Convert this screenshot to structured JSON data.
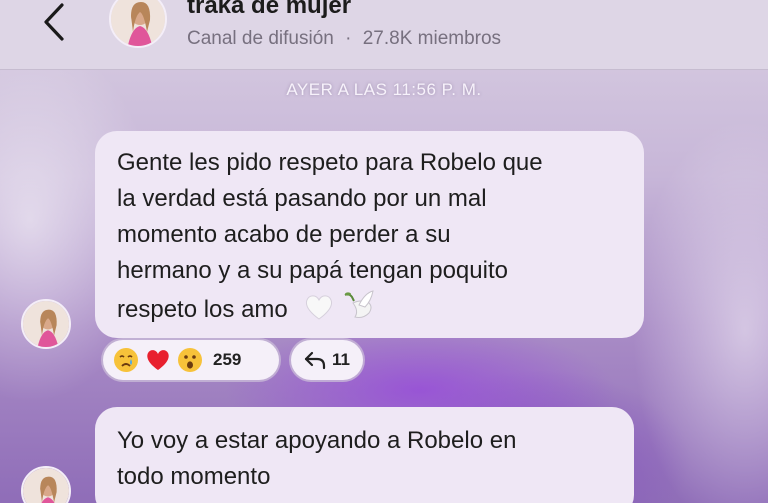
{
  "channel": {
    "name": "traka de mujer",
    "type_label": "Canal de difusión",
    "separator": "·",
    "members": "27.8K miembros"
  },
  "date_separator": "AYER A LAS 11:56 P. M.",
  "messages": [
    {
      "lines": [
        "Gente les pido respeto para Robelo que",
        "la verdad está pasando por un mal",
        "momento acabo de perder a su",
        "hermano y a su papá tengan poquito",
        "respeto los amo"
      ],
      "emojis": [
        "white-heart-icon",
        "dove-icon"
      ],
      "reactions": {
        "icons": [
          "crying-face-icon",
          "red-heart-icon",
          "surprised-face-icon"
        ],
        "count": "259"
      },
      "replies": "11"
    },
    {
      "lines": [
        "Yo voy a estar apoyando a Robelo en",
        "todo momento"
      ]
    }
  ]
}
